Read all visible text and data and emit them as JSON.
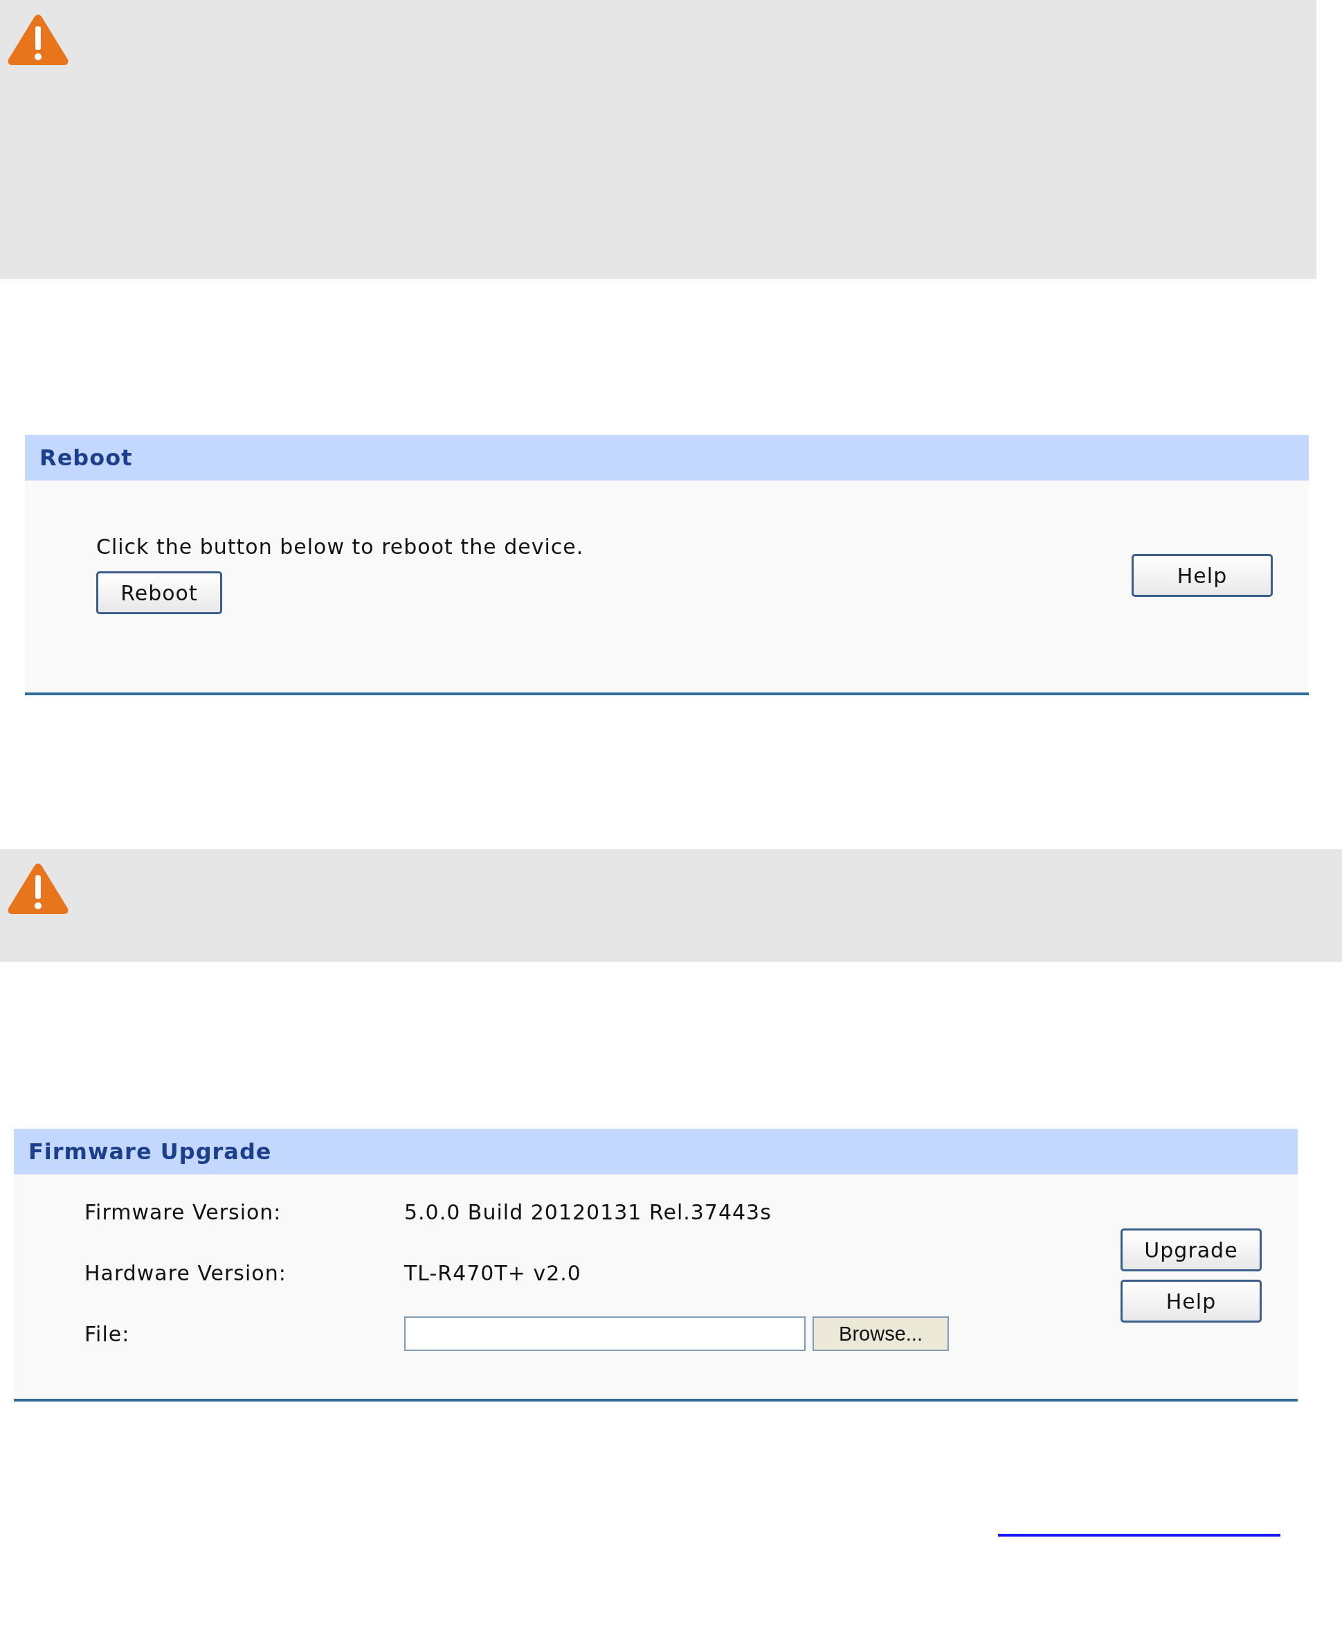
{
  "reboot_panel": {
    "title": "Reboot",
    "instruction": "Click the button below to reboot the device.",
    "action_button": "Reboot",
    "help_button": "Help"
  },
  "firmware_panel": {
    "title": "Firmware Upgrade",
    "fields": [
      {
        "kind": "text",
        "label": "Firmware Version:",
        "value": "5.0.0 Build 20120131 Rel.37443s"
      },
      {
        "kind": "text",
        "label": "Hardware Version:",
        "value": "TL-R470T+ v2.0"
      },
      {
        "kind": "file",
        "label": "File:",
        "button": "Browse..."
      }
    ],
    "buttons": [
      "Upgrade",
      "Help"
    ]
  }
}
